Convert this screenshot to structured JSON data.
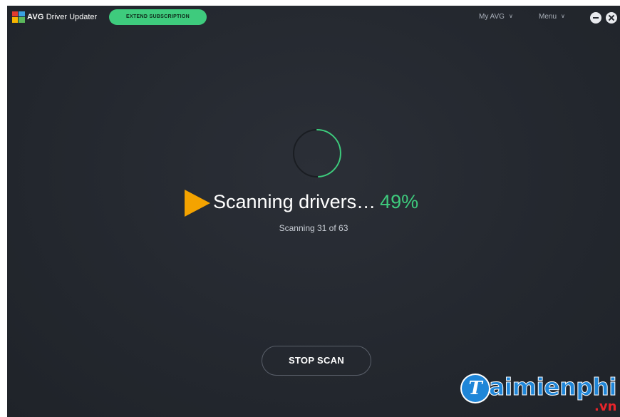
{
  "app": {
    "brand_name": "AVG",
    "product_name": "Driver Updater"
  },
  "header": {
    "extend_label": "EXTEND SUBSCRIPTION",
    "my_avg_label": "My AVG",
    "menu_label": "Menu"
  },
  "scan": {
    "title": "Scanning drivers…",
    "percent_text": "49%",
    "progress": 0.49,
    "status": "Scanning 31 of 63",
    "stop_label": "STOP SCAN"
  },
  "watermark": {
    "initial": "T",
    "text": "aimienphi",
    "suffix": ".vn"
  },
  "colors": {
    "accent_green": "#3ecb7d",
    "background": "#262a31",
    "play_orange": "#f4a300",
    "watermark_blue": "#1f86d8",
    "watermark_red": "#e8252b"
  },
  "icons": [
    "avg-logo-icon",
    "chevron-down-icon",
    "minimize-icon",
    "close-icon",
    "scan-spinner-icon",
    "play-arrow-icon"
  ]
}
